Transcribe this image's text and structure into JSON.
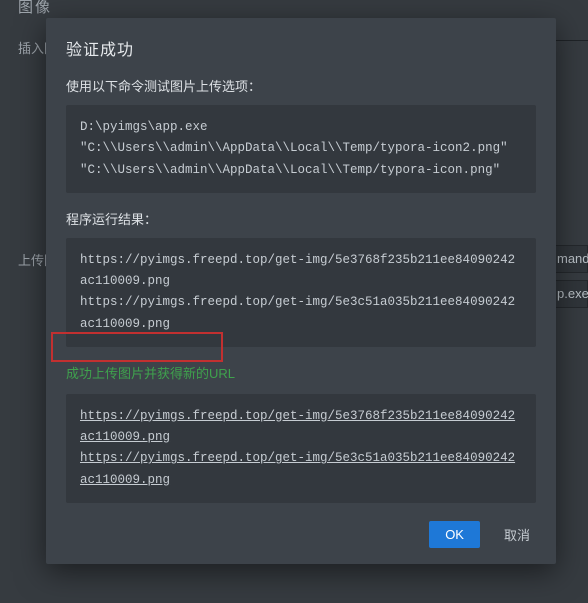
{
  "background": {
    "heading": "图像",
    "insert_label": "插入图",
    "upload_label": "上传图",
    "field1_tail": "mand",
    "field2_tail": "p.exe"
  },
  "modal": {
    "title": "验证成功",
    "cmd_label": "使用以下命令测试图片上传选项：",
    "cmd_lines": [
      "D:\\pyimgs\\app.exe",
      "\"C:\\\\Users\\\\admin\\\\AppData\\\\Local\\\\Temp/typora-icon2.png\"",
      "\"C:\\\\Users\\\\admin\\\\AppData\\\\Local\\\\Temp/typora-icon.png\""
    ],
    "result_label": "程序运行结果：",
    "result_lines": [
      "https://pyimgs.freepd.top/get-img/5e3768f235b211ee84090242ac110009.png",
      "https://pyimgs.freepd.top/get-img/5e3c51a035b211ee84090242ac110009.png"
    ],
    "success_msg": "成功上传图片并获得新的URL",
    "url_links": [
      "https://pyimgs.freepd.top/get-img/5e3768f235b211ee84090242ac110009.png",
      "https://pyimgs.freepd.top/get-img/5e3c51a035b211ee84090242ac110009.png"
    ],
    "ok_label": "OK",
    "cancel_label": "取消"
  }
}
